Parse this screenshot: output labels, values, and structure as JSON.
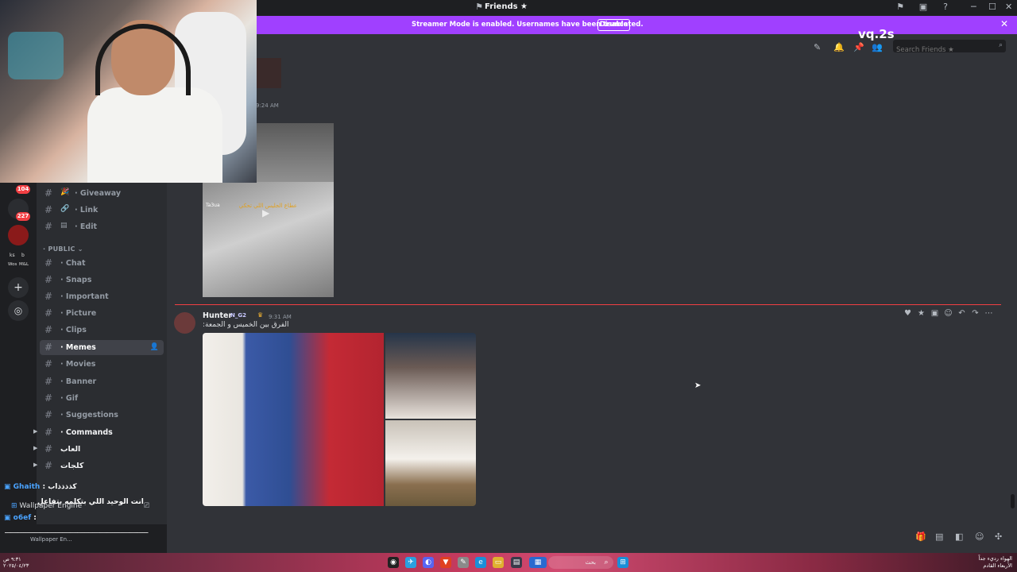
{
  "window": {
    "title": "Friends",
    "title_star": "★",
    "minimize": "─",
    "maximize": "☐",
    "close": "✕"
  },
  "banner": {
    "text": "Streamer Mode is enabled. Usernames have been truncated.",
    "button": "Disable",
    "close": "✕"
  },
  "servers": {
    "badges": [
      "104",
      "227"
    ],
    "labels": [
      "ks",
      "b",
      "Wos",
      "M&L"
    ]
  },
  "sidebar": {
    "channels_top": [
      {
        "name": "· Giveaway",
        "icon": "🎉"
      },
      {
        "name": "· Link",
        "icon": "🔗"
      },
      {
        "name": "· Edit",
        "icon": "▤"
      }
    ],
    "category": "PUBLIC",
    "channels": [
      {
        "name": "· Chat"
      },
      {
        "name": "· Snaps"
      },
      {
        "name": "· Important"
      },
      {
        "name": "· Picture"
      },
      {
        "name": "· Clips"
      },
      {
        "name": "· Memes"
      },
      {
        "name": "· Movies"
      },
      {
        "name": "· Banner"
      },
      {
        "name": "· Gif"
      },
      {
        "name": "· Suggestions"
      },
      {
        "name": "· Commands"
      },
      {
        "name": "العاب"
      },
      {
        "name": "كلجات"
      }
    ]
  },
  "header": {
    "search_placeholder": "Search Friends ★",
    "watermark": "vq.2s"
  },
  "messages": {
    "first_time": "9:24 AM",
    "video_caption": "عطاع الجليس اللي تحكي",
    "video_watermark": "Ta3ua",
    "author": "Hunter",
    "tag": "N_G2",
    "time": "9:31 AM",
    "text": "الفرق بين الخميس و الجمعة:"
  },
  "stream_chat": {
    "lines": [
      {
        "user": "Ghaith",
        "text": ": كذذذذاب"
      },
      {
        "user": "",
        "text": "انت الوحيد اللي بتكلمه بتفاعل"
      },
      {
        "user": "o6ef",
        "text": ":"
      }
    ],
    "marquee": "ـــــــــــــــــــــــــــــــــــــــــــــــــــــــــــــــــــــــــــــ",
    "wallpaper": "Wallpaper Engine",
    "wallpaper_short": "Wallpaper En..."
  },
  "taskbar": {
    "search": "بحث",
    "right_line1": "الهواء رديء جداً",
    "right_line2": "الأربعاء القادم",
    "left_time": "٩:٣١ ص",
    "left_date": "٢٠٢٥/٠٤/٢٣"
  },
  "colors": {
    "banner": "#a040ff",
    "badge": "#f23f43",
    "divider": "#f23f43",
    "background": "#313338",
    "sidebar": "#2b2d31"
  }
}
